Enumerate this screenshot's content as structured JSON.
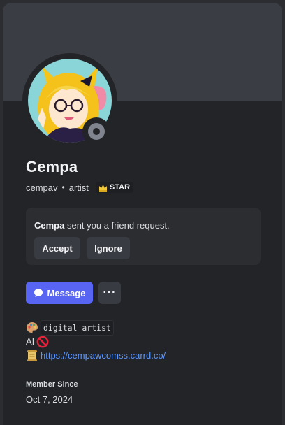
{
  "profile": {
    "display_name": "Cempa",
    "username": "cempav",
    "separator": "•",
    "pronouns": "artist",
    "guild_tag": "STAR",
    "status": "offline",
    "avatar_icon": "anime-girl-avatar"
  },
  "friend_request": {
    "name": "Cempa",
    "message": " sent you a friend request.",
    "accept_label": "Accept",
    "ignore_label": "Ignore"
  },
  "actions": {
    "message_label": "Message",
    "more_label": "···"
  },
  "bio": {
    "line1_emoji": "palette-icon",
    "line1_code": "digital artist",
    "line2_text": "AI",
    "line2_emoji": "no-entry-icon",
    "line3_emoji": "scroll-icon",
    "line3_link": "https://cempawcomss.carrd.co/"
  },
  "member_since": {
    "label": "Member Since",
    "date": "Oct 7, 2024"
  },
  "colors": {
    "card_bg": "#232428",
    "banner": "#3b3d44",
    "accent": "#5865f2",
    "link": "#5b97ff",
    "status_offline": "#80848e"
  }
}
